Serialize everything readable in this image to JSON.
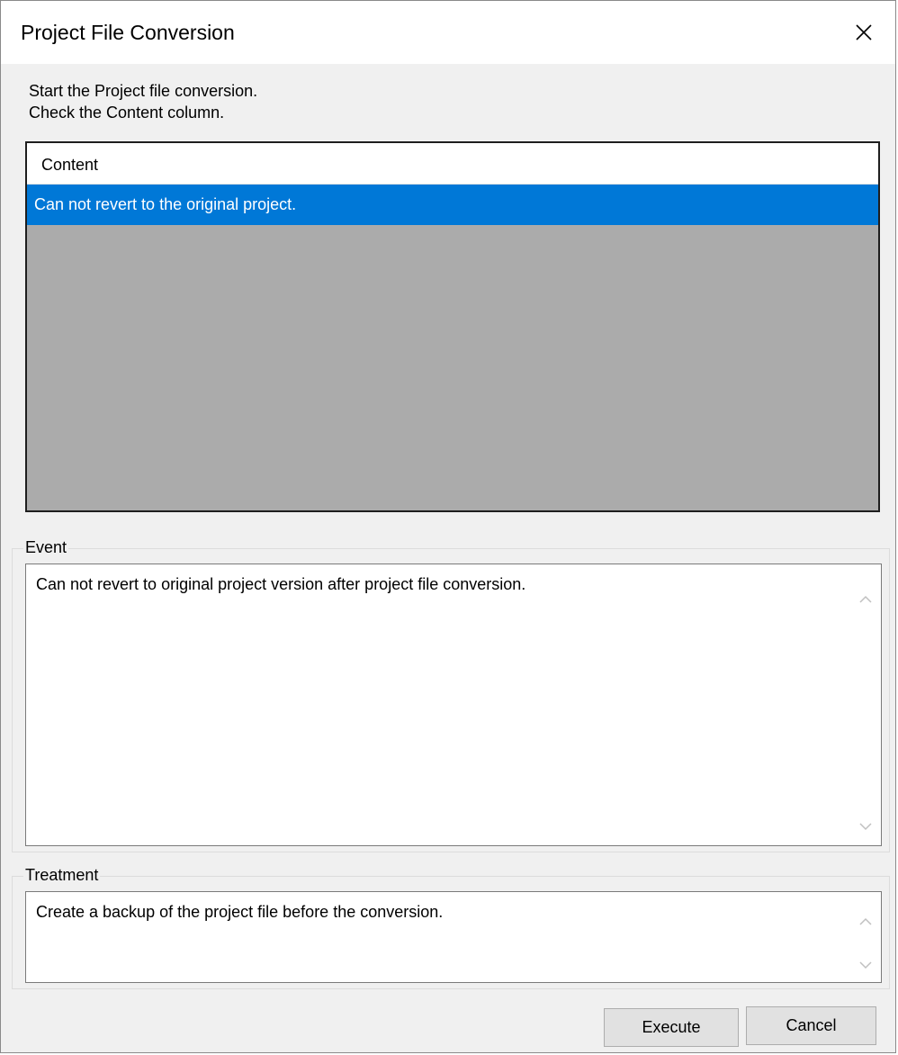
{
  "window": {
    "title": "Project File Conversion"
  },
  "intro": {
    "line1": "Start the Project file conversion.",
    "line2": "Check the Content column."
  },
  "content_list": {
    "header": "Content",
    "rows": [
      {
        "content": "Can not revert to the original project."
      }
    ],
    "selected_index": 0
  },
  "event": {
    "label": "Event",
    "text": "Can not revert to original project version after project file conversion."
  },
  "treatment": {
    "label": "Treatment",
    "text": "Create a backup of the project file before the conversion."
  },
  "buttons": {
    "execute": "Execute",
    "cancel": "Cancel"
  },
  "colors": {
    "selection": "#0078d7",
    "list_background": "#ababab",
    "dialog_background": "#f0f0f0"
  }
}
